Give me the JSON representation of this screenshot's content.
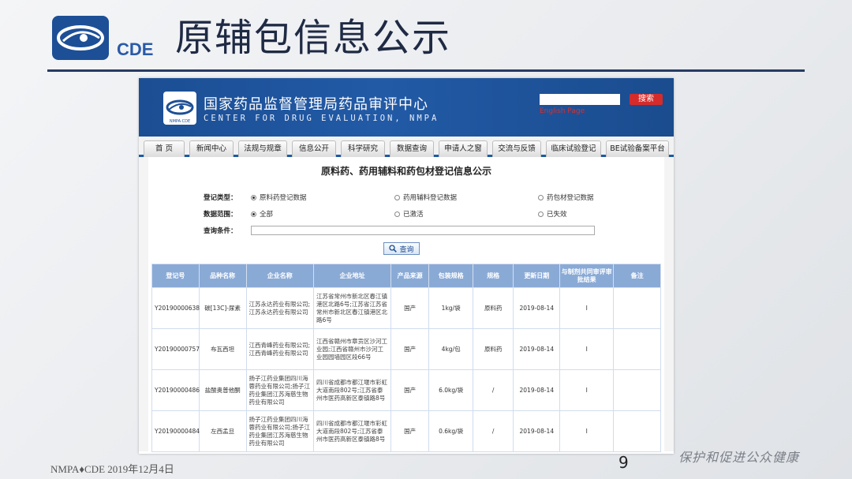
{
  "slide": {
    "logo_text": "CDE",
    "title": "原辅包信息公示",
    "footer_left": "NMPA♦CDE  2019年12月4日",
    "page_number": "9",
    "slogan": "保护和促进公众健康"
  },
  "site": {
    "title_cn": "国家药品监督管理局药品审评中心",
    "title_en": "CENTER FOR DRUG EVALUATION, NMPA",
    "search_button": "搜索",
    "english_link": "English Page",
    "nav": [
      "首 页",
      "新闻中心",
      "法规与规章",
      "信息公开",
      "科学研究",
      "数据查询",
      "申请人之窗",
      "交流与反馈",
      "临床试验登记",
      "BE试验备案平台"
    ]
  },
  "form": {
    "page_title": "原料药、药用辅料和药包材登记信息公示",
    "reg_type_label": "登记类型：",
    "reg_type_options": [
      "原料药登记数据",
      "药用辅料登记数据",
      "药包材登记数据"
    ],
    "scope_label": "数据范围：",
    "scope_options": [
      "全部",
      "已激活",
      "已失效"
    ],
    "query_label": "查询条件：",
    "query_value": "",
    "query_button": "查询"
  },
  "table": {
    "headers": [
      "登记号",
      "品种名称",
      "企业名称",
      "企业地址",
      "产品来源",
      "包装规格",
      "规格",
      "更新日期",
      "与制剂共同审评审批结果",
      "备注"
    ],
    "rows": [
      [
        "Y20190000638",
        "碳[13C]-尿素",
        "江苏永达药业有限公司;江苏永达药业有限公司",
        "江苏省常州市新北区春江镇港区北路6号;江苏省江苏省常州市新北区春江镇港区北路6号",
        "国产",
        "1kg/袋",
        "原料药",
        "2019-08-14",
        "I",
        ""
      ],
      [
        "Y20190000757",
        "布瓦西坦",
        "江西青峰药业有限公司;江西青峰药业有限公司",
        "江西省赣州市章贡区沙河工业园;江西省赣州市沙河工业园园墙园区段66号",
        "国产",
        "4kg/包",
        "原料药",
        "2019-08-14",
        "I",
        ""
      ],
      [
        "Y20190000486",
        "盐酸奥普他酮",
        "扬子江药业集团四川海蓉药业有限公司;扬子江药业集团江苏海慈生物药业有限公司",
        "四川省成都市都江堰市彩虹大道南段802号;江苏省泰州市医药高新区泰镇路8号",
        "国产",
        "6.0kg/袋",
        "/",
        "2019-08-14",
        "I",
        ""
      ],
      [
        "Y20190000484",
        "左西孟旦",
        "扬子江药业集团四川海蓉药业有限公司;扬子江药业集团江苏海慈生物药业有限公司",
        "四川省成都市都江堰市彩虹大道南段802号;江苏省泰州市医药高新区泰镇路8号",
        "国产",
        "0.6kg/袋",
        "/",
        "2019-08-14",
        "I",
        ""
      ]
    ]
  },
  "colors": {
    "site_header": "#1f55a0",
    "table_header": "#8aaad6",
    "title_rule": "#273b63",
    "search_button": "#d62b2b"
  }
}
